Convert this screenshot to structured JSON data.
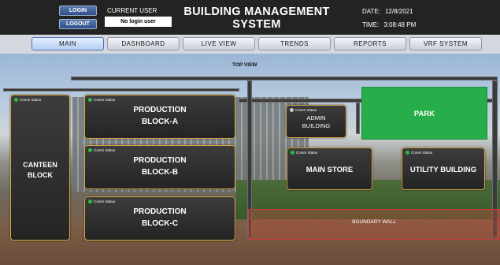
{
  "header": {
    "login_label": "LOGIN",
    "logout_label": "LOGOUT",
    "current_user_label": "CURRENT USER",
    "current_user_value": "No login user",
    "title_line1": "BUILDING MANAGEMENT",
    "title_line2": "SYSTEM",
    "date_label": "DATE:",
    "date_value": "12/8/2021",
    "time_label": "TIME:",
    "time_value": "3:08:48 PM"
  },
  "nav": {
    "active": "MAIN",
    "tabs": [
      "MAIN",
      "DASHBOARD",
      "LIVE VIEW",
      "TRENDS",
      "REPORTS",
      "VRF SYSTEM"
    ]
  },
  "scene": {
    "top_view_label": "TOP VIEW",
    "boundary_wall_label": "Boundary Wall",
    "comm_status_label": "Comm Status",
    "blocks": {
      "canteen": {
        "line1": "CANTEEN",
        "line2": "BLOCK",
        "status": "ok"
      },
      "prod_a": {
        "line1": "PRODUCTION",
        "line2": "BLOCK-A",
        "status": "ok"
      },
      "prod_b": {
        "line1": "PRODUCTION",
        "line2": "BLOCK-B",
        "status": "ok"
      },
      "prod_c": {
        "line1": "PRODUCTION",
        "line2": "BLOCK-C",
        "status": "ok"
      },
      "admin": {
        "line1": "ADMIN",
        "line2": "BUILDING",
        "status": "unknown"
      },
      "main_store": {
        "line1": "MAIN STORE",
        "status": "ok"
      },
      "utility": {
        "line1": "UTILITY BUILDING",
        "status": "ok"
      },
      "park": {
        "line1": "PARK"
      }
    }
  },
  "colors": {
    "status_ok": "#2dbe3a",
    "status_unknown": "#c9c9c9",
    "block_border": "#d9a441",
    "park": "#27ad4a",
    "boundary": "#c83a3a"
  }
}
